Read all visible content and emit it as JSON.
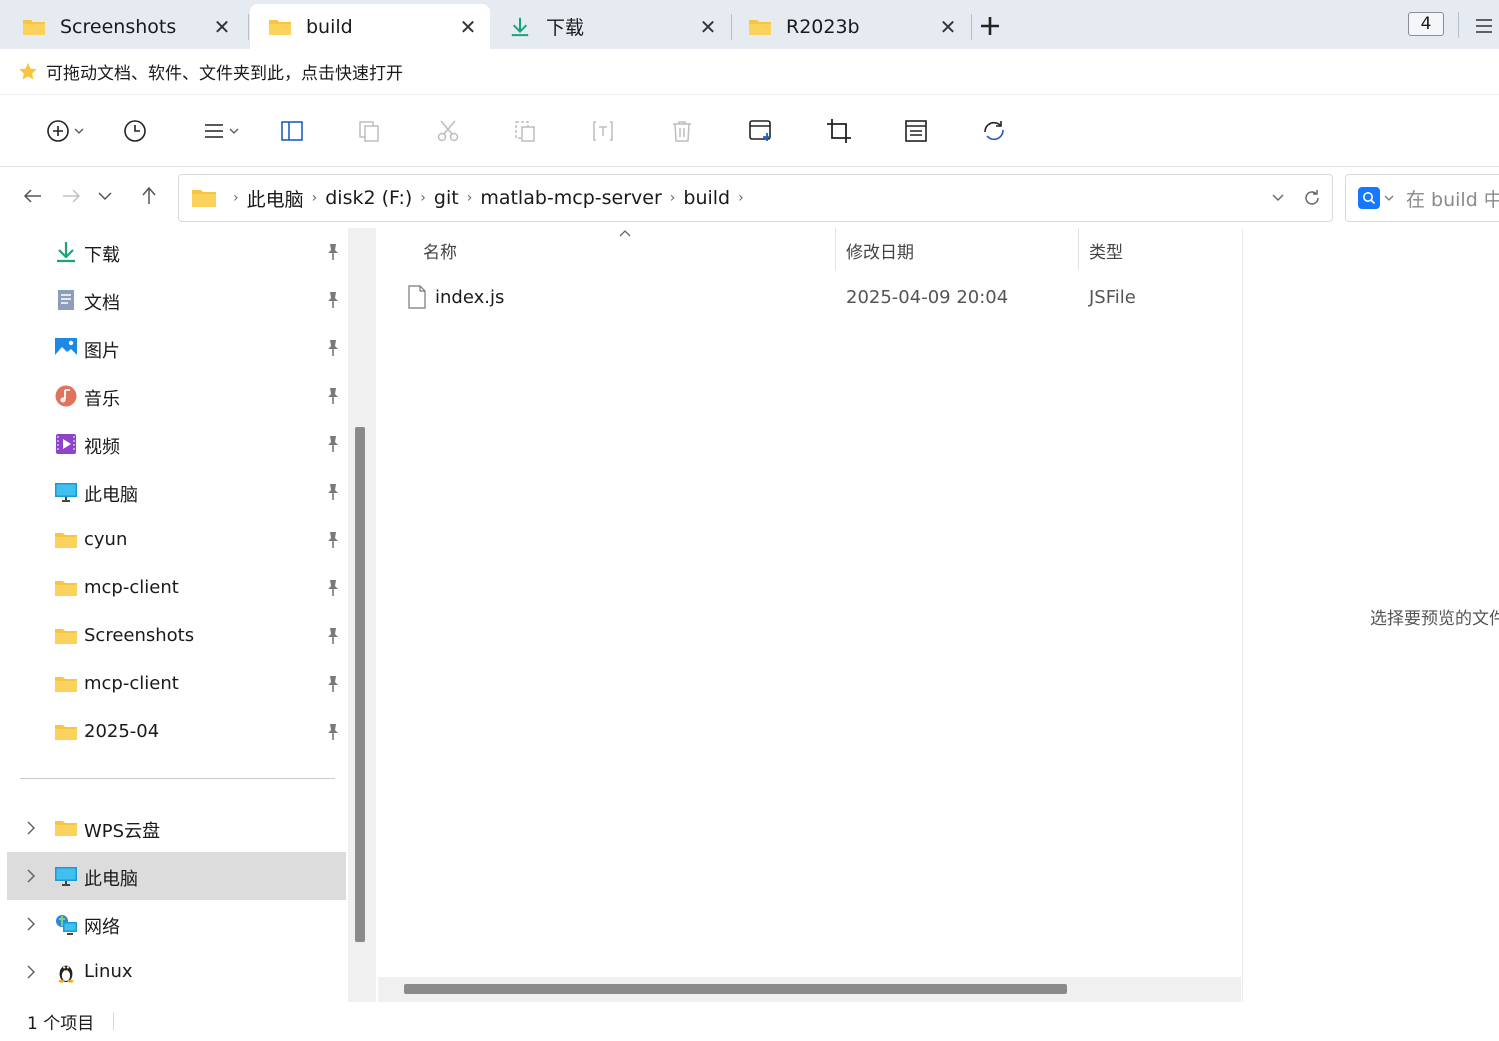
{
  "tabs": [
    {
      "label": "Screenshots",
      "icon": "folder-icon",
      "active": false
    },
    {
      "label": "build",
      "icon": "folder-icon",
      "active": true
    },
    {
      "label": "下载",
      "icon": "download-icon",
      "active": false
    },
    {
      "label": "R2023b",
      "icon": "folder-icon",
      "active": false
    }
  ],
  "tab_count": "4",
  "favorites": {
    "hint": "可拖动文档、软件、文件夹到此，点击快速打开"
  },
  "toolbar": {
    "icons": [
      "new-icon",
      "history-icon",
      "view-menu-icon",
      "details-pane-icon",
      "copy-icon",
      "cut-icon",
      "paste-icon",
      "rename-icon",
      "delete-icon",
      "new-window-icon",
      "crop-icon",
      "properties-icon",
      "sync-icon"
    ]
  },
  "address": {
    "crumbs": [
      "此电脑",
      "disk2 (F:)",
      "git",
      "matlab-mcp-server",
      "build"
    ]
  },
  "search": {
    "placeholder": "在 build 中"
  },
  "sidebar": {
    "quick_access": [
      {
        "label": "下载",
        "icon": "download-icon"
      },
      {
        "label": "文档",
        "icon": "documents-icon"
      },
      {
        "label": "图片",
        "icon": "pictures-icon"
      },
      {
        "label": "音乐",
        "icon": "music-icon"
      },
      {
        "label": "视频",
        "icon": "videos-icon"
      },
      {
        "label": "此电脑",
        "icon": "computer-icon"
      },
      {
        "label": "cyun",
        "icon": "folder-icon"
      },
      {
        "label": "mcp-client",
        "icon": "folder-icon"
      },
      {
        "label": "Screenshots",
        "icon": "folder-icon"
      },
      {
        "label": "mcp-client",
        "icon": "folder-icon"
      },
      {
        "label": "2025-04",
        "icon": "folder-icon"
      }
    ],
    "tree": [
      {
        "label": "WPS云盘",
        "icon": "folder-icon",
        "selected": false
      },
      {
        "label": "此电脑",
        "icon": "computer-icon",
        "selected": true
      },
      {
        "label": "网络",
        "icon": "network-icon",
        "selected": false
      },
      {
        "label": "Linux",
        "icon": "linux-icon",
        "selected": false
      }
    ]
  },
  "list": {
    "columns": {
      "name": "名称",
      "modified": "修改日期",
      "type": "类型"
    },
    "rows": [
      {
        "name": "index.js",
        "modified": "2025-04-09 20:04",
        "type": "JSFile"
      }
    ]
  },
  "preview": {
    "text": "选择要预览的文件"
  },
  "status": {
    "count": "1 个项目"
  },
  "colors": {
    "tabbar_bg": "#e6ebf2",
    "folder_yellow": "#f8c542",
    "accent_blue": "#1677ff",
    "download_teal": "#1aa37a"
  }
}
